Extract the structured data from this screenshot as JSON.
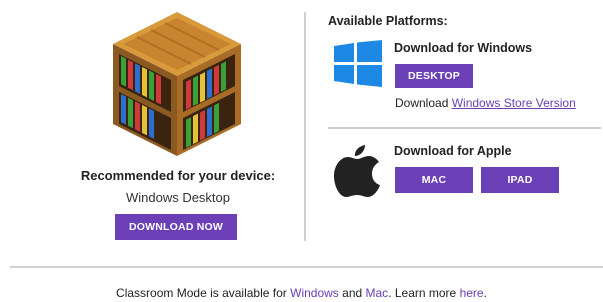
{
  "recommended": {
    "title": "Recommended for your device:",
    "device": "Windows Desktop",
    "button": "DOWNLOAD NOW",
    "logo_icon": "bookshelf-block-icon"
  },
  "platforms": {
    "heading": "Available Platforms:",
    "windows": {
      "title": "Download for Windows",
      "desktop_button": "DESKTOP",
      "store_prefix": "Download ",
      "store_link": "Windows Store Version",
      "icon": "windows-logo-icon"
    },
    "apple": {
      "title": "Download for Apple",
      "mac_button": "MAC",
      "ipad_button": "IPAD",
      "icon": "apple-logo-icon"
    }
  },
  "footer": {
    "prefix": "Classroom Mode is available for ",
    "windows_link": "Windows",
    "and": " and ",
    "mac_link": "Mac",
    "middle": ". Learn more ",
    "here_link": "here",
    "suffix": "."
  },
  "colors": {
    "accent": "#6b3fb5",
    "divider": "#d0d0d0",
    "windows_blue": "#1e88e5"
  }
}
